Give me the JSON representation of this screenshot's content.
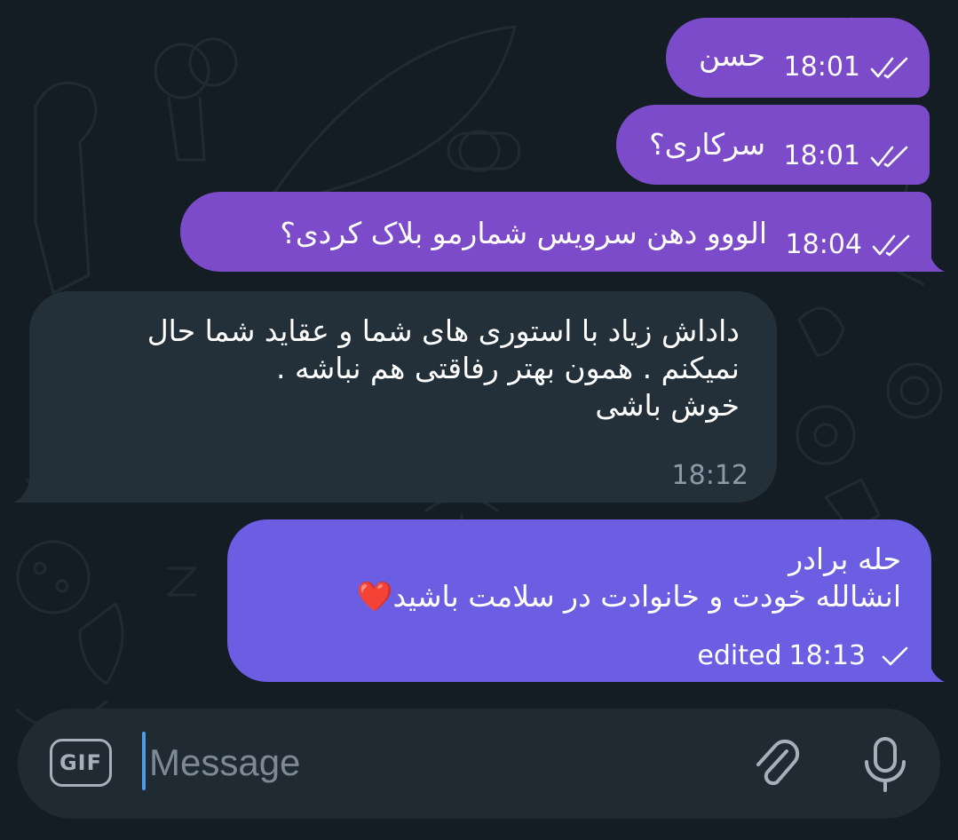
{
  "chat": {
    "messages": [
      {
        "direction": "outgoing",
        "text": "حسن",
        "time": "18:01",
        "status": "read"
      },
      {
        "direction": "outgoing",
        "text": "سرکاری؟",
        "time": "18:01",
        "status": "read"
      },
      {
        "direction": "outgoing",
        "text": "الووو دهن سرویس شمارمو بلاک کردی؟",
        "time": "18:04",
        "status": "read"
      },
      {
        "direction": "incoming",
        "text": "داداش زیاد با استوری های شما و عقاید شما حال\nنمیکنم . همون بهتر رفاقتی هم نباشه .\nخوش باشی",
        "time": "18:12"
      },
      {
        "direction": "outgoing",
        "text": "حله برادر\nانشالله خودت و خانوادت در سلامت باشید❤️",
        "edited_label": "edited",
        "time": "18:13",
        "status": "sent"
      }
    ]
  },
  "composer": {
    "gif_label": "GIF",
    "placeholder": "Message",
    "value": ""
  },
  "colors": {
    "background": "#141d24",
    "outgoing_bubble": "#7b4bc9",
    "outgoing_bubble_last": "#6b5ee3",
    "incoming_bubble": "#243039",
    "accent": "#4d9ce3"
  },
  "icons": {
    "read": "double-check-icon",
    "sent": "check-icon",
    "attach": "paperclip-icon",
    "voice": "microphone-icon"
  }
}
